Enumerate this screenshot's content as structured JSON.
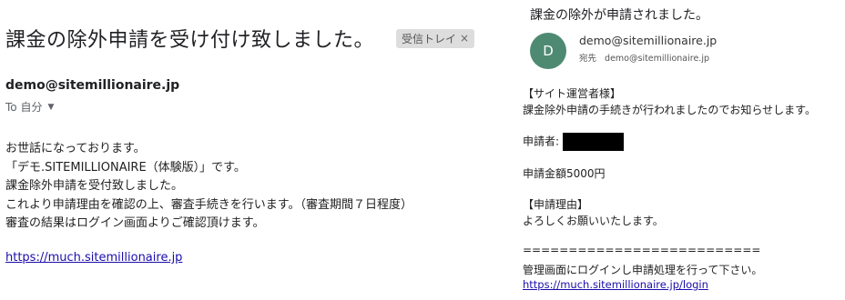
{
  "left_email": {
    "subject": "課金の除外申請を受け付け致しました。",
    "inbox_chip": {
      "label": "受信トレイ",
      "close": "×"
    },
    "sender": "demo@sitemillionaire.jp",
    "to_label": "To 自分",
    "body_lines": [
      "お世話になっております。",
      "「デモ.SITEMILLIONAIRE（体験版）」です。",
      "課金除外申請を受付致しました。",
      "これより申請理由を確認の上、審査手続きを行います。（審査期間７日程度）",
      "審査の結果はログイン画面よりご確認頂けます。"
    ],
    "link": "https://much.sitemillionaire.jp"
  },
  "right_email": {
    "subject": "課金の除外が申請されました。",
    "avatar_initial": "D",
    "from": "demo@sitemillionaire.jp",
    "to_label": "宛先",
    "to": "demo@sitemillionaire.jp",
    "greeting": "【サイト運営者様】",
    "intro": "課金除外申請の手続きが行われましたのでお知らせします。",
    "applicant_label": "申請者:",
    "amount": "申請金額5000円",
    "reason_label": "【申請理由】",
    "reason": "よろしくお願いいたします。",
    "separator": "==========================",
    "footer": "管理画面にログインし申請処理を行って下さい。",
    "link": "https://much.sitemillionaire.jp/login"
  }
}
